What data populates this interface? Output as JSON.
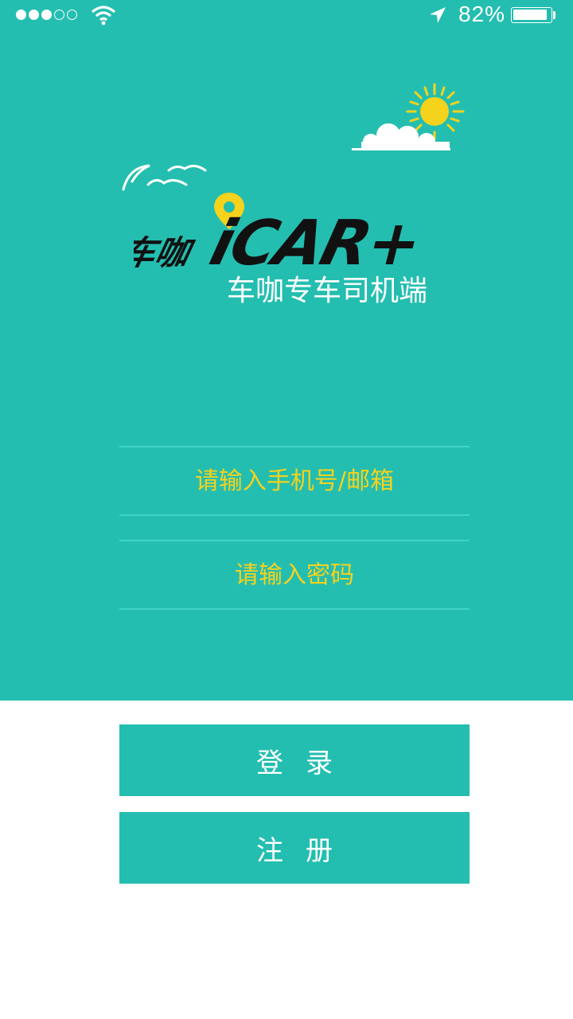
{
  "status_bar": {
    "battery_percent_text": "82%",
    "battery_level": 0.82,
    "signal_bars_filled": 3,
    "signal_bars_total": 5
  },
  "logo": {
    "chinese_mark": "车咖",
    "wordmark": "iCAR+",
    "subtitle": "车咖专车司机端"
  },
  "form": {
    "phone_placeholder": "请输入手机号/邮箱",
    "password_placeholder": "请输入密码"
  },
  "buttons": {
    "login_label": "登录",
    "register_label": "注册"
  },
  "colors": {
    "brand_teal": "#24beb0",
    "accent_yellow": "#f5d21c",
    "divider": "#3fd4c6"
  }
}
